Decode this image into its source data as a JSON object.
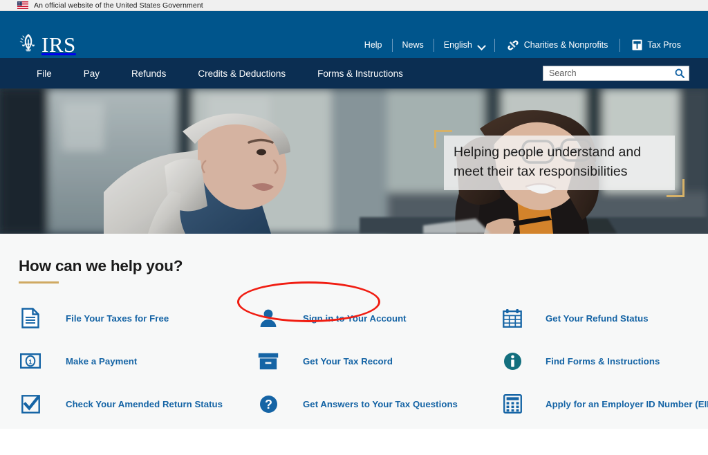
{
  "gov_banner": {
    "text": "An official website of the United States Government",
    "flag_icon": "us-flag-icon"
  },
  "header": {
    "logo_text": "IRS",
    "logo_icon": "irs-eagle-scales-emblem",
    "utility_nav": [
      {
        "label": "Help",
        "icon": null
      },
      {
        "label": "News",
        "icon": null
      },
      {
        "label": "English",
        "icon": "chevron-down-icon"
      },
      {
        "label": "Charities & Nonprofits",
        "icon": "charities-hands-icon"
      },
      {
        "label": "Tax Pros",
        "icon": "tax-pros-book-icon"
      }
    ]
  },
  "primary_nav": {
    "items": [
      {
        "label": "File"
      },
      {
        "label": "Pay"
      },
      {
        "label": "Refunds"
      },
      {
        "label": "Credits & Deductions"
      },
      {
        "label": "Forms & Instructions"
      }
    ],
    "search": {
      "placeholder": "Search",
      "value": "",
      "button_icon": "search-icon"
    }
  },
  "hero": {
    "caption_line1": "Helping people understand and",
    "caption_line2": "meet their tax responsibilities",
    "image_description": "Two women looking at a laptop in an office"
  },
  "help": {
    "title": "How can we help you?",
    "links": [
      {
        "label": "File Your Taxes for Free",
        "icon": "document-icon",
        "column": 0,
        "row": 0
      },
      {
        "label": "Sign in to Your Account",
        "icon": "person-icon",
        "column": 1,
        "row": 0
      },
      {
        "label": "Get Your Refund Status",
        "icon": "calendar-icon",
        "column": 2,
        "row": 0
      },
      {
        "label": "Make a Payment",
        "icon": "dollar-bill-icon",
        "column": 0,
        "row": 1
      },
      {
        "label": "Get Your Tax Record",
        "icon": "archive-box-icon",
        "column": 1,
        "row": 1
      },
      {
        "label": "Find Forms & Instructions",
        "icon": "info-circle-icon",
        "column": 2,
        "row": 1
      },
      {
        "label": "Check Your Amended Return Status",
        "icon": "checkbox-icon",
        "column": 0,
        "row": 2
      },
      {
        "label": "Get Answers to Your Tax Questions",
        "icon": "question-circle-icon",
        "column": 1,
        "row": 2
      },
      {
        "label": "Apply for an Employer ID Number (EIN)",
        "icon": "calculator-icon",
        "column": 2,
        "row": 2
      }
    ]
  },
  "annotation": {
    "shape": "ellipse",
    "color": "#f01d12",
    "targets_label": "Sign in to Your Account"
  },
  "colors": {
    "header_blue": "#00558c",
    "nav_navy": "#0b2e52",
    "link_blue": "#1564a5",
    "accent_gold": "#cfa962",
    "section_bg": "#f7f8f8",
    "annotation_red": "#f01d12"
  }
}
